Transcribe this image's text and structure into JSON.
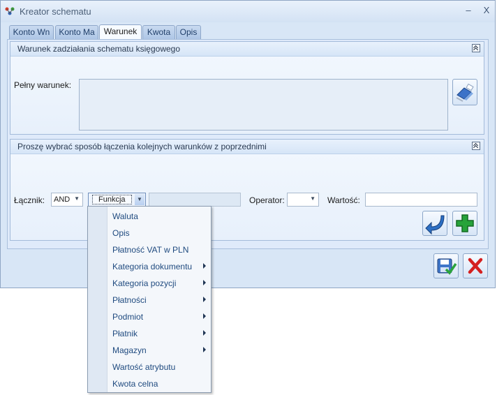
{
  "window": {
    "title": "Kreator schematu",
    "minimize_glyph": "–",
    "close_glyph": "X"
  },
  "tabs": [
    {
      "label": "Konto Wn",
      "active": false
    },
    {
      "label": "Konto Ma",
      "active": false
    },
    {
      "label": "Warunek",
      "active": true
    },
    {
      "label": "Kwota",
      "active": false
    },
    {
      "label": "Opis",
      "active": false
    }
  ],
  "section_condition": {
    "title": "Warunek zadziałania schematu księgowego",
    "full_condition_label": "Pełny warunek:",
    "full_condition_value": ""
  },
  "section_join": {
    "title": "Proszę wybrać sposób łączenia kolejnych warunków z poprzednimi",
    "connector_label": "Łącznik:",
    "connector_value": "AND",
    "function_value": "Funkcja",
    "operator_label": "Operator:",
    "operator_value": "",
    "value_label": "Wartość:",
    "value_value": ""
  },
  "function_menu": {
    "items": [
      {
        "label": "Waluta",
        "submenu": false
      },
      {
        "label": "Opis",
        "submenu": false
      },
      {
        "label": "Płatność VAT w PLN",
        "submenu": false
      },
      {
        "label": "Kategoria dokumentu",
        "submenu": true
      },
      {
        "label": "Kategoria pozycji",
        "submenu": true
      },
      {
        "label": "Płatności",
        "submenu": true
      },
      {
        "label": "Podmiot",
        "submenu": true
      },
      {
        "label": "Płatnik",
        "submenu": true
      },
      {
        "label": "Magazyn",
        "submenu": true
      },
      {
        "label": "Wartość atrybutu",
        "submenu": false
      },
      {
        "label": "Kwota celna",
        "submenu": false
      }
    ]
  },
  "colors": {
    "accent_blue": "#2d6fc4",
    "add_green": "#27a33a",
    "cancel_red": "#d42020"
  }
}
